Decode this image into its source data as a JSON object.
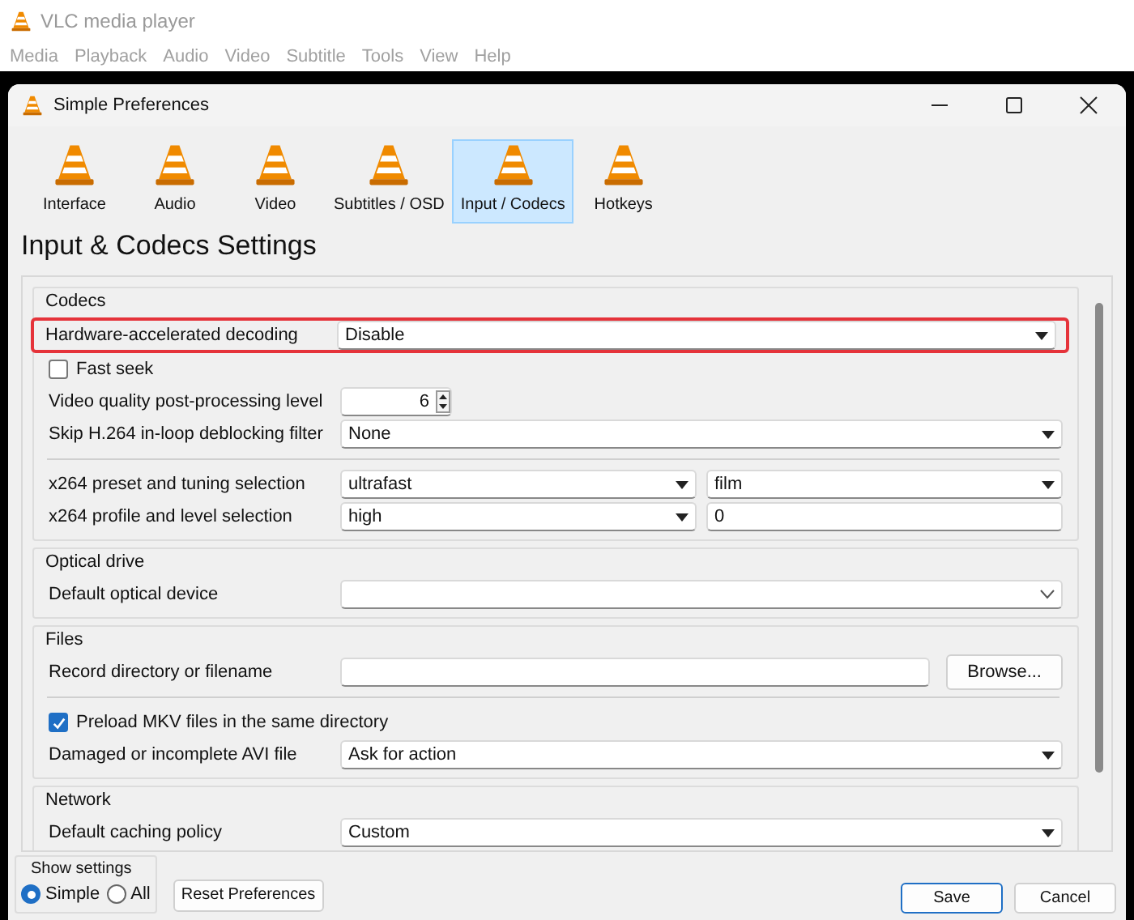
{
  "app": {
    "title": "VLC media player",
    "menu": [
      "Media",
      "Playback",
      "Audio",
      "Video",
      "Subtitle",
      "Tools",
      "View",
      "Help"
    ]
  },
  "dialog": {
    "title": "Simple Preferences",
    "categories": [
      {
        "label": "Interface",
        "selected": false
      },
      {
        "label": "Audio",
        "selected": false
      },
      {
        "label": "Video",
        "selected": false
      },
      {
        "label": "Subtitles / OSD",
        "selected": false
      },
      {
        "label": "Input / Codecs",
        "selected": true
      },
      {
        "label": "Hotkeys",
        "selected": false
      }
    ],
    "heading": "Input & Codecs Settings",
    "sections": [
      {
        "title": "Codecs",
        "rows": [
          {
            "kind": "setting",
            "label": "Hardware-accelerated decoding",
            "highlighted": true,
            "controls": [
              {
                "kind": "dropdown",
                "value": "Disable"
              }
            ]
          },
          {
            "kind": "checkbox",
            "label": "Fast seek",
            "checked": false
          },
          {
            "kind": "setting",
            "label": "Video quality post-processing level",
            "highlighted": false,
            "controls": [
              {
                "kind": "spin",
                "value": "6"
              }
            ]
          },
          {
            "kind": "setting",
            "label": "Skip H.264 in-loop deblocking filter",
            "highlighted": false,
            "controls": [
              {
                "kind": "dropdown",
                "value": "None"
              }
            ]
          },
          {
            "kind": "separator"
          },
          {
            "kind": "setting",
            "label": "x264 preset and tuning selection",
            "highlighted": false,
            "controls": [
              {
                "kind": "dropdown",
                "value": "ultrafast"
              },
              {
                "kind": "dropdown",
                "value": "film"
              }
            ]
          },
          {
            "kind": "setting",
            "label": "x264 profile and level selection",
            "highlighted": false,
            "controls": [
              {
                "kind": "dropdown",
                "value": "high"
              },
              {
                "kind": "field",
                "value": "0"
              }
            ]
          }
        ]
      },
      {
        "title": "Optical drive",
        "rows": [
          {
            "kind": "setting",
            "label": "Default optical device",
            "highlighted": false,
            "controls": [
              {
                "kind": "combo"
              }
            ]
          }
        ]
      },
      {
        "title": "Files",
        "rows": [
          {
            "kind": "setting",
            "label": "Record directory or filename",
            "highlighted": false,
            "controls": [
              {
                "kind": "field"
              },
              {
                "kind": "button",
                "value": "Browse..."
              }
            ]
          },
          {
            "kind": "separator"
          },
          {
            "kind": "checkbox",
            "label": "Preload MKV files in the same directory",
            "checked": true
          },
          {
            "kind": "setting",
            "label": "Damaged or incomplete AVI file",
            "highlighted": false,
            "controls": [
              {
                "kind": "dropdown",
                "value": "Ask for action"
              }
            ]
          }
        ]
      },
      {
        "title": "Network",
        "rows": [
          {
            "kind": "setting",
            "label": "Default caching policy",
            "highlighted": false,
            "controls": [
              {
                "kind": "dropdown",
                "value": "Custom"
              }
            ]
          }
        ]
      }
    ],
    "footer": {
      "show_settings": {
        "title": "Show settings",
        "options": [
          {
            "label": "Simple",
            "selected": true
          },
          {
            "label": "All",
            "selected": false
          }
        ]
      },
      "reset": "Reset Preferences",
      "buttons": [
        {
          "label": "Save",
          "default": true
        },
        {
          "label": "Cancel",
          "default": false
        }
      ]
    }
  }
}
